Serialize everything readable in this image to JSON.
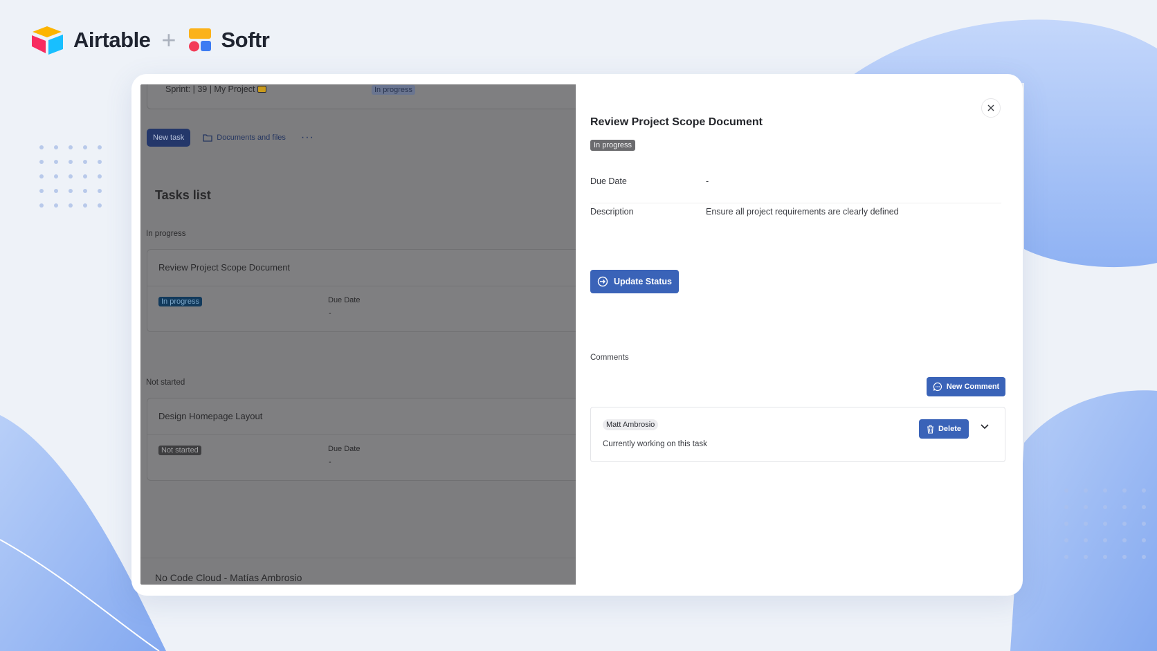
{
  "branding": {
    "airtable_name": "Airtable",
    "plus": "+",
    "softr_name": "Softr"
  },
  "app": {
    "sprint_bar": {
      "text": "Sprint: | 39 | My Project",
      "badge": "In progress"
    },
    "toolbar": {
      "new_task_label": "New task",
      "documents_label": "Documents and files",
      "more_label": "···"
    },
    "tasks_title": "Tasks list",
    "groups": [
      {
        "label": "In progress",
        "task": {
          "title": "Review Project Scope Document",
          "status": "In progress",
          "due_label": "Due Date",
          "due_value": "-"
        }
      },
      {
        "label": "Not started",
        "task": {
          "title": "Design Homepage Layout",
          "status": "Not started",
          "due_label": "Due Date",
          "due_value": "-"
        }
      }
    ],
    "footer_text": "No Code Cloud - Matías Ambrosio"
  },
  "drawer": {
    "title": "Review Project Scope Document",
    "status_badge": "In progress",
    "fields": [
      {
        "label": "Due Date",
        "value": "-"
      },
      {
        "label": "Description",
        "value": "Ensure all project requirements are clearly defined"
      }
    ],
    "update_status_label": "Update Status",
    "comments_label": "Comments",
    "new_comment_label": "New Comment",
    "comment": {
      "author": "Matt Ambrosio",
      "text": "Currently working on this task",
      "delete_label": "Delete"
    }
  },
  "colors": {
    "primary_button": "#3a63b8",
    "overlay_dim": "#7d7d7f",
    "in_progress_badge": "#123a5c",
    "background_blob": "#a8c4f5"
  }
}
